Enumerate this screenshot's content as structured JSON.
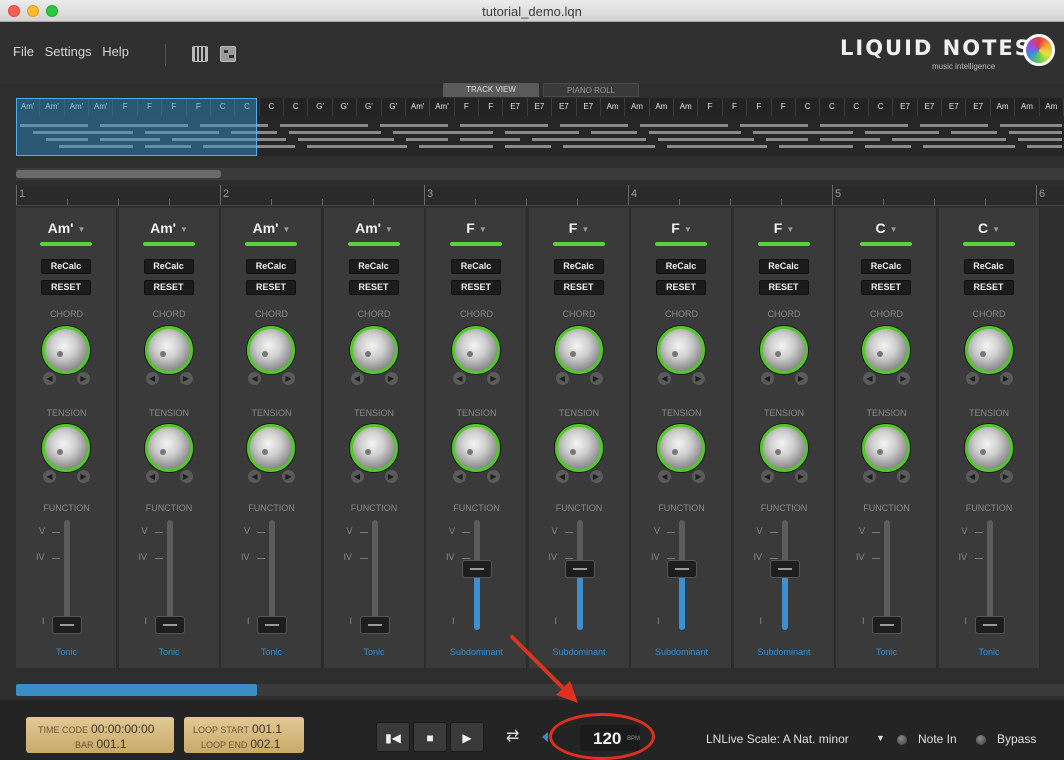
{
  "window": {
    "title": "tutorial_demo.lqn"
  },
  "menu": [
    "File",
    "Settings",
    "Help"
  ],
  "tools": [
    "piano-keyboard-icon",
    "grid-editor-icon"
  ],
  "logo": {
    "text": "LIQUID NOTES",
    "sub": "music intelligence"
  },
  "view_tabs": [
    {
      "label": "TRACK VIEW",
      "active": true
    },
    {
      "label": "PIANO ROLL",
      "active": false
    }
  ],
  "chord_strip": [
    "Am'",
    "Am'",
    "Am'",
    "Am'",
    "F",
    "F",
    "F",
    "F",
    "C",
    "C",
    "C",
    "C",
    "G'",
    "G'",
    "G'",
    "G'",
    "Am'",
    "Am'",
    "F",
    "F",
    "E7",
    "E7",
    "E7",
    "E7",
    "Am",
    "Am",
    "Am",
    "Am",
    "F",
    "F",
    "F",
    "F",
    "C",
    "C",
    "C",
    "C",
    "E7",
    "E7",
    "E7",
    "E7",
    "Am",
    "Am",
    "Am"
  ],
  "ruler": [
    "1",
    "2",
    "3",
    "4",
    "5",
    "6"
  ],
  "section_labels": {
    "chord": "CHORD",
    "tension": "TENSION",
    "function": "FUNCTION"
  },
  "buttons": {
    "recalc": "ReCalc",
    "reset": "RESET"
  },
  "fader_marks": {
    "v": "V",
    "iv": "IV",
    "i": "I"
  },
  "strips": [
    {
      "chord": "Am'",
      "function": "Tonic",
      "level": 0
    },
    {
      "chord": "Am'",
      "function": "Tonic",
      "level": 0
    },
    {
      "chord": "Am'",
      "function": "Tonic",
      "level": 0
    },
    {
      "chord": "Am'",
      "function": "Tonic",
      "level": 0
    },
    {
      "chord": "F",
      "function": "Subdominant",
      "level": 0.7
    },
    {
      "chord": "F",
      "function": "Subdominant",
      "level": 0.7
    },
    {
      "chord": "F",
      "function": "Subdominant",
      "level": 0.7
    },
    {
      "chord": "F",
      "function": "Subdominant",
      "level": 0.7
    },
    {
      "chord": "C",
      "function": "Tonic",
      "level": 0
    },
    {
      "chord": "C",
      "function": "Tonic",
      "level": 0
    }
  ],
  "transport": {
    "timecode_label": "TIME CODE",
    "timecode": "00:00:00:00",
    "bar_label": "BAR",
    "bar": "001.1",
    "loop_start_label": "LOOP START",
    "loop_start": "001.1",
    "loop_end_label": "LOOP END",
    "loop_end": "002.1",
    "bpm": "120",
    "bpm_unit": "BPM",
    "scale": "LNLive Scale: A Nat. minor",
    "note_in": "Note In",
    "bypass": "Bypass"
  },
  "colors": {
    "accent_green": "#5bd13b",
    "accent_blue": "#3c8fd0",
    "annotation_red": "#e0301e"
  }
}
